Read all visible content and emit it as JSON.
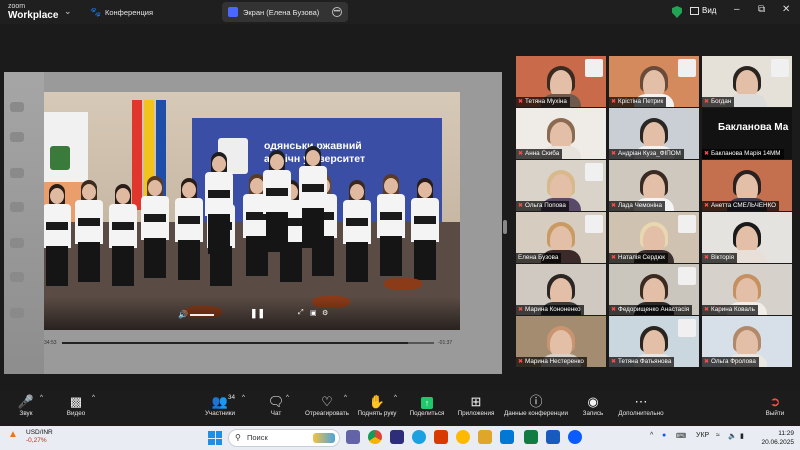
{
  "titlebar": {
    "app_name_line1": "zoom",
    "app_name_line2": "Workplace",
    "tabs": [
      {
        "label": "Конференция",
        "icon": "paw-icon"
      },
      {
        "label": "Экран (Елена Бузова)",
        "icon": "screen-share-icon"
      }
    ],
    "view_label": "Вид",
    "colors": {
      "secure": "#21a453",
      "tab_active_bg": "#333333"
    }
  },
  "shared_video": {
    "banner_text_line1": "одянськи",
    "banner_text_line2": "ржавний",
    "banner_text_line3": "агогічн",
    "banner_text_line4": "університет",
    "time_current": "34:53",
    "time_remaining": "-01:37",
    "progress": 0.93
  },
  "gallery": {
    "active_speaker": "Елена Бузова",
    "tiles": [
      {
        "name": "Тетяна Мухіна",
        "muted": true
      },
      {
        "name": "Крістіна Петрик",
        "muted": true
      },
      {
        "name": "Богдан",
        "muted": true
      },
      {
        "name": "Анна Скиба",
        "muted": true
      },
      {
        "name": "Андріан Куза_ФІПОМ",
        "muted": true
      },
      {
        "name": "Бакланова Марія 14ММ",
        "muted": true,
        "large_text": "Бакланова Ма"
      },
      {
        "name": "Ольга Попова",
        "muted": true
      },
      {
        "name": "Лада Чемоніна",
        "muted": true
      },
      {
        "name": "Анетта СМЕЛЬЧЕНКО",
        "muted": true
      },
      {
        "name": "Елена Бузова",
        "muted": false
      },
      {
        "name": "Наталія Сердюк",
        "muted": true
      },
      {
        "name": "Вікторія",
        "muted": true
      },
      {
        "name": "Марина Кононенко",
        "muted": true
      },
      {
        "name": "Федорищенко Анастасія",
        "muted": true
      },
      {
        "name": "Карина Коваль",
        "muted": true
      },
      {
        "name": "Марина Нестеренко",
        "muted": true
      },
      {
        "name": "Тетяна Фатьянова",
        "muted": true
      },
      {
        "name": "Ольга Фролова",
        "muted": true
      }
    ]
  },
  "toolbar": {
    "audio": "Звук",
    "video": "Видео",
    "participants": "Участники",
    "participants_count": "34",
    "chat": "Чат",
    "react": "Отреагировать",
    "raise_hand": "Поднять руку",
    "share": "Поделиться",
    "apps": "Приложения",
    "conf_data": "Данные конференции",
    "record": "Запись",
    "more": "Дополнительно",
    "leave": "Выйти"
  },
  "taskbar": {
    "ticker": "USD/INR",
    "ticker_change": "-0,27%",
    "search_placeholder": "Поиск",
    "language": "УКР",
    "time": "11:29",
    "date": "20.06.2025"
  }
}
